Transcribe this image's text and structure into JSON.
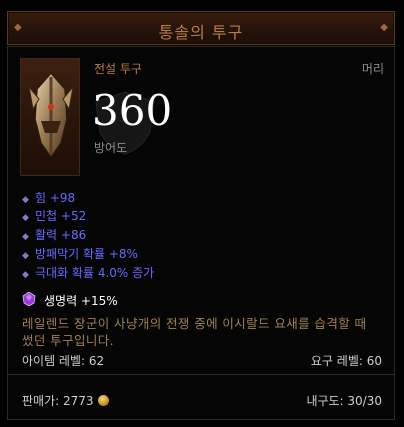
{
  "item": {
    "name": "통솔의 투구",
    "rarity": "전설 투구",
    "slot": "머리",
    "armor_value": "360",
    "armor_label": "방어도"
  },
  "affixes": [
    {
      "text": "힘 +98"
    },
    {
      "text": "민첩 +52"
    },
    {
      "text": "활력 +86"
    },
    {
      "text": "방패막기 확률 +8%"
    },
    {
      "text": "극대화 확률 4.0% 증가"
    }
  ],
  "socket": {
    "gem_icon": "amethyst-gem-icon",
    "text": "생명력 +15%"
  },
  "flavor": "레일렌드 장군이 사냥개의 전쟁 중에 이시랄드 요새를 습격할 때 썼던 투구입니다.",
  "item_level": "아이템 레벨: 62",
  "required_level": "요구 레벨: 60",
  "sell_price": "판매가: 2773",
  "durability": "내구도: 30/30",
  "colors": {
    "title": "#b67c3d",
    "magic_affix": "#6969ff",
    "flavor": "#a08050",
    "label": "#8d8d8d"
  }
}
